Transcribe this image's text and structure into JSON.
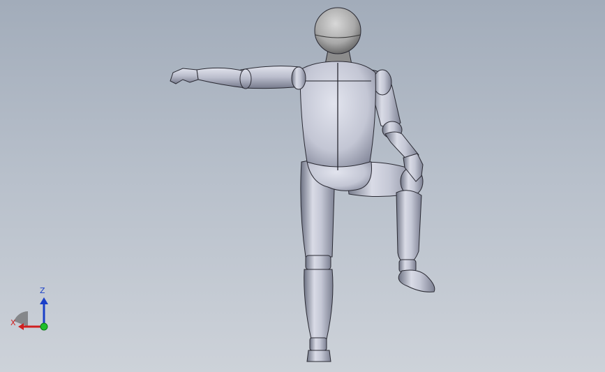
{
  "viewport": {
    "background_top": "#a2acba",
    "background_bottom": "#cdd2d9"
  },
  "model": {
    "parts": [
      "head",
      "neck",
      "torso",
      "upper-arm-left",
      "forearm-left",
      "hand-left",
      "upper-arm-right",
      "forearm-right",
      "hand-right",
      "pelvis",
      "thigh-left",
      "knee-left",
      "shin-left",
      "foot-left",
      "thigh-right",
      "shin-right",
      "foot-right"
    ],
    "surface_color": "#c2c5d3",
    "edge_color": "#1c1c24"
  },
  "triad": {
    "z_label": "Z",
    "x_label": "X",
    "z_color": "#1a3fc8",
    "x_color": "#d02020",
    "y_color": "#1fbf2a"
  }
}
